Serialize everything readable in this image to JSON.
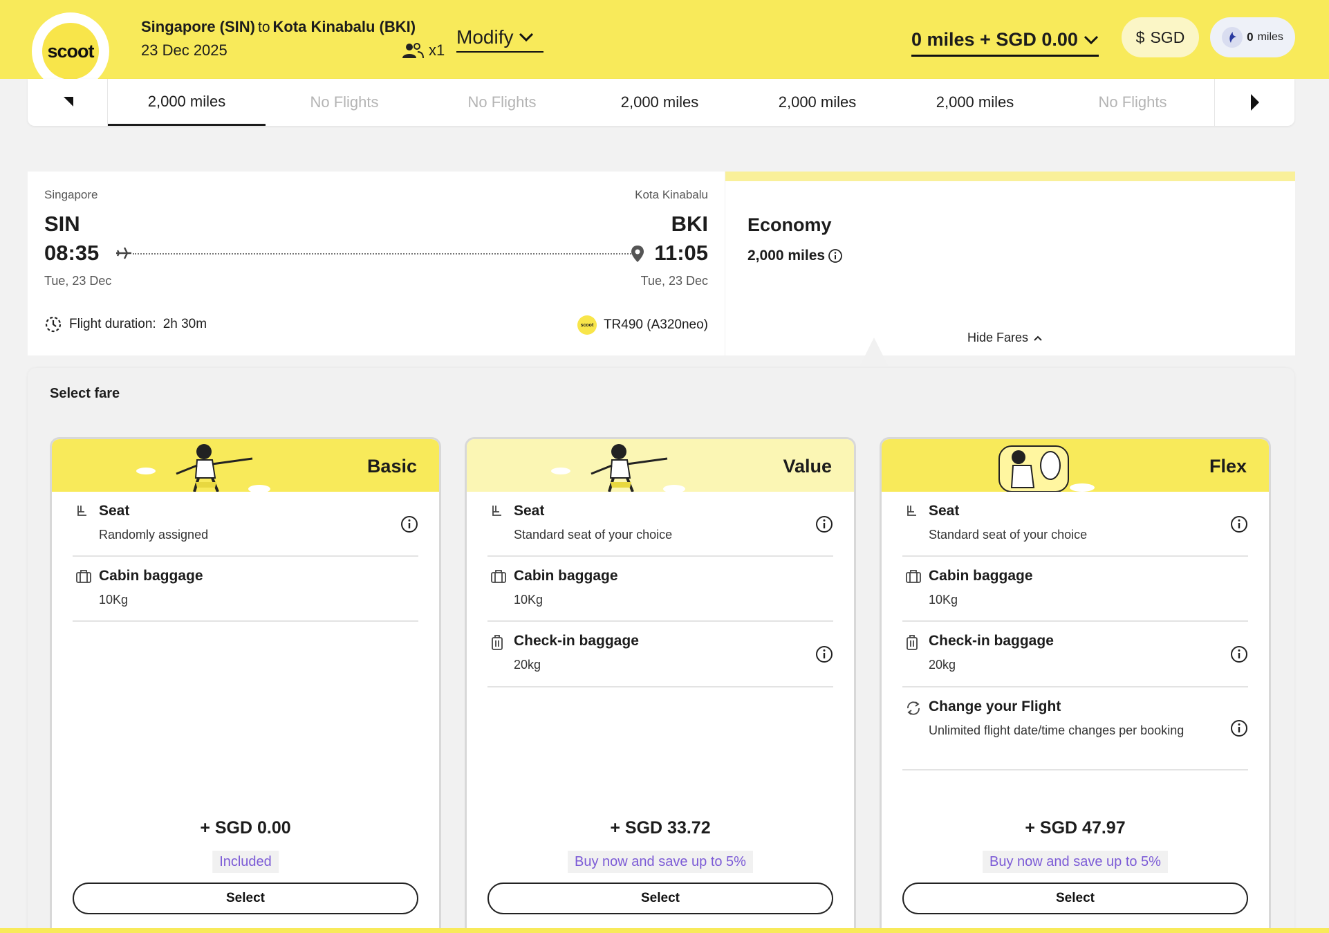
{
  "brand": {
    "logo_text": "scoot",
    "accent": "#f8ea5a",
    "purple": "#7b5ad6"
  },
  "header": {
    "origin": "Singapore (SIN)",
    "to_word": "to",
    "destination": "Kota Kinabalu (BKI)",
    "date": "23 Dec 2025",
    "pax": "x1",
    "modify_label": "Modify",
    "total": "0 miles + SGD 0.00",
    "currency": "SGD",
    "currency_symbol": "$",
    "miles_value": "0",
    "miles_label": "miles"
  },
  "date_strip": {
    "tabs": [
      {
        "label": "2,000 miles",
        "state": "active"
      },
      {
        "label": "No Flights",
        "state": "disabled"
      },
      {
        "label": "No Flights",
        "state": "disabled"
      },
      {
        "label": "2,000 miles",
        "state": "normal"
      },
      {
        "label": "2,000 miles",
        "state": "normal"
      },
      {
        "label": "2,000 miles",
        "state": "normal"
      },
      {
        "label": "No Flights",
        "state": "disabled"
      }
    ]
  },
  "flight": {
    "origin_city": "Singapore",
    "origin_code": "SIN",
    "depart_time": "08:35",
    "depart_day": "Tue, 23 Dec",
    "dest_city": "Kota Kinabalu",
    "dest_code": "BKI",
    "arrive_time": "11:05",
    "arrive_day": "Tue, 23 Dec",
    "duration_label": "Flight duration:",
    "duration": "2h 30m",
    "flight_no": "TR490 (A320neo)"
  },
  "economy": {
    "title": "Economy",
    "miles": "2,000 miles",
    "hide_label": "Hide Fares"
  },
  "fare_panel": {
    "title": "Select fare",
    "fares": [
      {
        "name": "Basic",
        "features": [
          {
            "title": "Seat",
            "desc": "Randomly assigned"
          },
          {
            "title": "Cabin baggage",
            "desc": "10Kg"
          }
        ],
        "price": "+ SGD 0.00",
        "badge": "Included",
        "button": "Select"
      },
      {
        "name": "Value",
        "features": [
          {
            "title": "Seat",
            "desc": "Standard seat of your choice"
          },
          {
            "title": "Cabin baggage",
            "desc": "10Kg"
          },
          {
            "title": "Check-in baggage",
            "desc": "20kg"
          }
        ],
        "price": "+ SGD 33.72",
        "badge": "Buy now and save up to 5%",
        "button": "Select"
      },
      {
        "name": "Flex",
        "features": [
          {
            "title": "Seat",
            "desc": "Standard seat of your choice"
          },
          {
            "title": "Cabin baggage",
            "desc": "10Kg"
          },
          {
            "title": "Check-in baggage",
            "desc": "20kg"
          },
          {
            "title": "Change your Flight",
            "desc": "Unlimited flight date/time changes per booking"
          }
        ],
        "price": "+ SGD 47.97",
        "badge": "Buy now and save up to 5%",
        "button": "Select"
      }
    ]
  }
}
